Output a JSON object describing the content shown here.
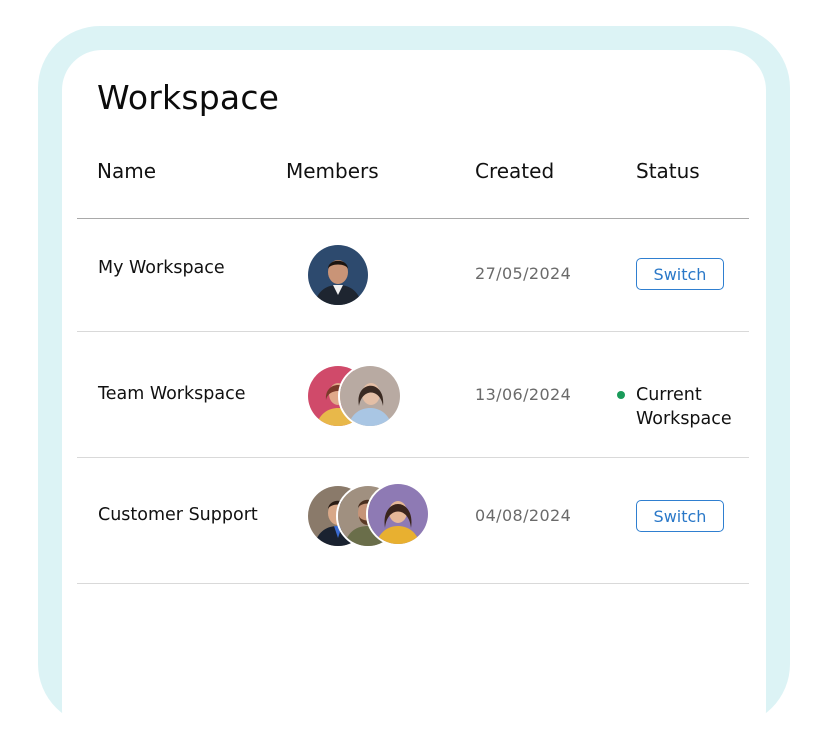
{
  "panel": {
    "title": "Workspace"
  },
  "table": {
    "columns": [
      "Name",
      "Members",
      "Created",
      "Status"
    ],
    "rows": [
      {
        "name": "My Workspace",
        "members": [
          "man-avatar"
        ],
        "created": "27/05/2024",
        "status": "Switch"
      },
      {
        "name": "Team Workspace",
        "members": [
          "woman-pink-avatar",
          "woman-gray-avatar"
        ],
        "created": "13/06/2024",
        "status": "Current Workspace"
      },
      {
        "name": "Customer Support",
        "members": [
          "man-suit-avatar",
          "man-beard-avatar",
          "woman-purple-avatar"
        ],
        "created": "04/08/2024",
        "status": "Switch"
      }
    ]
  },
  "colors": {
    "frame": "#dcf3f5",
    "switch_border": "#2f7fd0",
    "current_dot": "#1a9b5a"
  }
}
